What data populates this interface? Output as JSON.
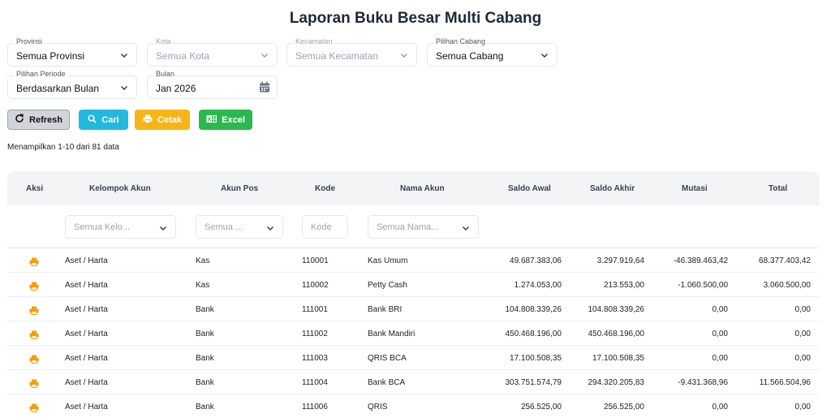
{
  "page": {
    "title": "Laporan Buku Besar Multi Cabang"
  },
  "filters": {
    "provinsi": {
      "label": "Provinsi",
      "value": "Semua Provinsi"
    },
    "kota": {
      "label": "Kota",
      "value": "Semua Kota"
    },
    "kecamatan": {
      "label": "Kecamatan",
      "value": "Semua Kecamatan"
    },
    "cabang": {
      "label": "Pilihan Cabang",
      "value": "Semua Cabang"
    },
    "periode": {
      "label": "Pilihan Periode",
      "value": "Berdasarkan Bulan"
    },
    "bulan": {
      "label": "Bulan",
      "value": "Jan 2026"
    }
  },
  "toolbar": {
    "refresh_label": "Refresh",
    "cari_label": "Cari",
    "cetak_label": "Cetak",
    "excel_label": "Excel"
  },
  "summary": "Menampilkan 1-10 dari 81 data",
  "table": {
    "headers": {
      "aksi": "Aksi",
      "kelompok": "Kelompok Akun",
      "akunpos": "Akun Pos",
      "kode": "Kode",
      "nama": "Nama Akun",
      "saldo_awal": "Saldo Awal",
      "saldo_akhir": "Saldo Akhir",
      "mutasi": "Mutasi",
      "total": "Total"
    },
    "column_filters": {
      "kelompok": "Semua Kelo...",
      "akunpos": "Semua ...",
      "kode": "Kode",
      "nama": "Semua Nama..."
    },
    "rows": [
      {
        "kelompok": "Aset / Harta",
        "akunpos": "Kas",
        "kode": "110001",
        "nama": "Kas Umum",
        "saldo_awal": "49.687.383,06",
        "saldo_akhir": "3.297.919,64",
        "mutasi": "-46.389.463,42",
        "total": "68.377.403,42"
      },
      {
        "kelompok": "Aset / Harta",
        "akunpos": "Kas",
        "kode": "110002",
        "nama": "Petty Cash",
        "saldo_awal": "1.274.053,00",
        "saldo_akhir": "213.553,00",
        "mutasi": "-1.060.500,00",
        "total": "3.060.500,00"
      },
      {
        "kelompok": "Aset / Harta",
        "akunpos": "Bank",
        "kode": "111001",
        "nama": "Bank BRI",
        "saldo_awal": "104.808.339,26",
        "saldo_akhir": "104.808.339,26",
        "mutasi": "0,00",
        "total": "0,00"
      },
      {
        "kelompok": "Aset / Harta",
        "akunpos": "Bank",
        "kode": "111002",
        "nama": "Bank Mandiri",
        "saldo_awal": "450.468.196,00",
        "saldo_akhir": "450.468.196,00",
        "mutasi": "0,00",
        "total": "0,00"
      },
      {
        "kelompok": "Aset / Harta",
        "akunpos": "Bank",
        "kode": "111003",
        "nama": "QRIS BCA",
        "saldo_awal": "17.100.508,35",
        "saldo_akhir": "17.100.508,35",
        "mutasi": "0,00",
        "total": "0,00"
      },
      {
        "kelompok": "Aset / Harta",
        "akunpos": "Bank",
        "kode": "111004",
        "nama": "Bank BCA",
        "saldo_awal": "303.751.574,79",
        "saldo_akhir": "294.320.205,83",
        "mutasi": "-9.431.368,96",
        "total": "11.566.504,96"
      },
      {
        "kelompok": "Aset / Harta",
        "akunpos": "Bank",
        "kode": "111006",
        "nama": "QRIS",
        "saldo_awal": "256.525,00",
        "saldo_akhir": "256.525,00",
        "mutasi": "0,00",
        "total": "0,00"
      }
    ]
  },
  "colors": {
    "cari": "#22b8e0",
    "cetak": "#f6b417",
    "excel": "#2bb94f",
    "print_icon": "#f59e0b"
  }
}
